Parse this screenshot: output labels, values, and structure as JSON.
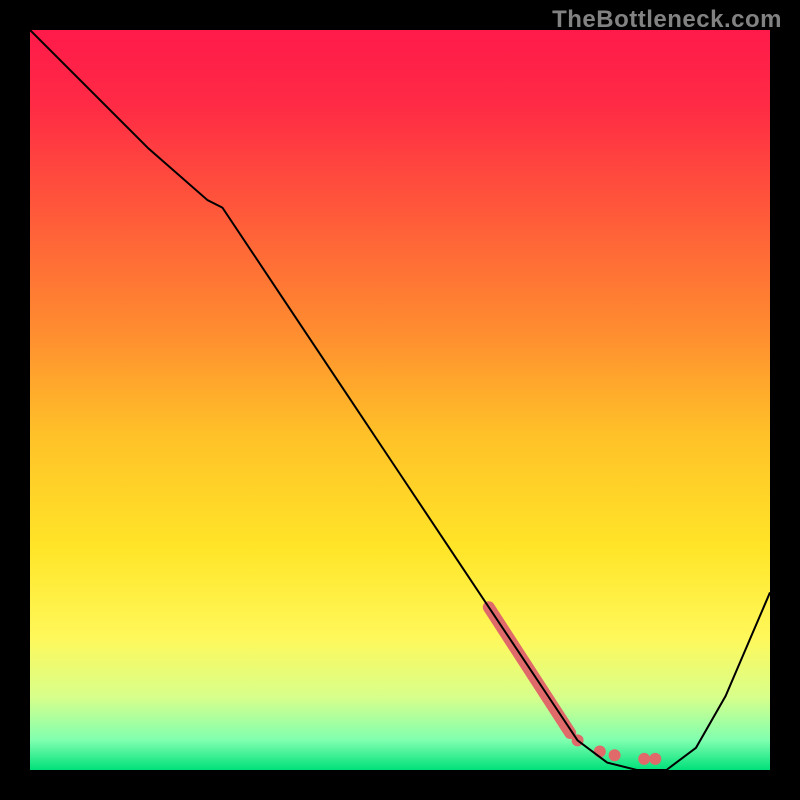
{
  "watermark": "TheBottleneck.com",
  "chart_data": {
    "type": "line",
    "title": "",
    "xlabel": "",
    "ylabel": "",
    "xlim": [
      0,
      100
    ],
    "ylim": [
      0,
      100
    ],
    "background_gradient": {
      "stops": [
        {
          "offset": 0.0,
          "color": "#ff1a4a"
        },
        {
          "offset": 0.1,
          "color": "#ff2a45"
        },
        {
          "offset": 0.25,
          "color": "#ff5a3a"
        },
        {
          "offset": 0.4,
          "color": "#ff8a30"
        },
        {
          "offset": 0.55,
          "color": "#ffc228"
        },
        {
          "offset": 0.7,
          "color": "#ffe528"
        },
        {
          "offset": 0.82,
          "color": "#fff85a"
        },
        {
          "offset": 0.9,
          "color": "#d9ff8a"
        },
        {
          "offset": 0.96,
          "color": "#7fffb0"
        },
        {
          "offset": 1.0,
          "color": "#00e07a"
        }
      ]
    },
    "series": [
      {
        "name": "bottleneck-curve",
        "color": "#000000",
        "stroke_width": 2,
        "x": [
          0,
          8,
          16,
          24,
          26,
          34,
          42,
          50,
          58,
          66,
          70,
          74,
          78,
          82,
          86,
          90,
          94,
          100
        ],
        "y": [
          100,
          92,
          84,
          77,
          76,
          64,
          52,
          40,
          28,
          16,
          10,
          4,
          1,
          0,
          0,
          3,
          10,
          24
        ]
      }
    ],
    "highlight": {
      "name": "optimal-range",
      "color": "#e06a6a",
      "segment": {
        "x": [
          62,
          73
        ],
        "y": [
          22,
          5
        ],
        "width": 12
      },
      "dots": [
        {
          "x": 74,
          "y": 4
        },
        {
          "x": 77,
          "y": 2.5
        },
        {
          "x": 79,
          "y": 2
        },
        {
          "x": 83,
          "y": 1.5
        },
        {
          "x": 84.5,
          "y": 1.5
        }
      ],
      "dot_radius": 6
    }
  }
}
